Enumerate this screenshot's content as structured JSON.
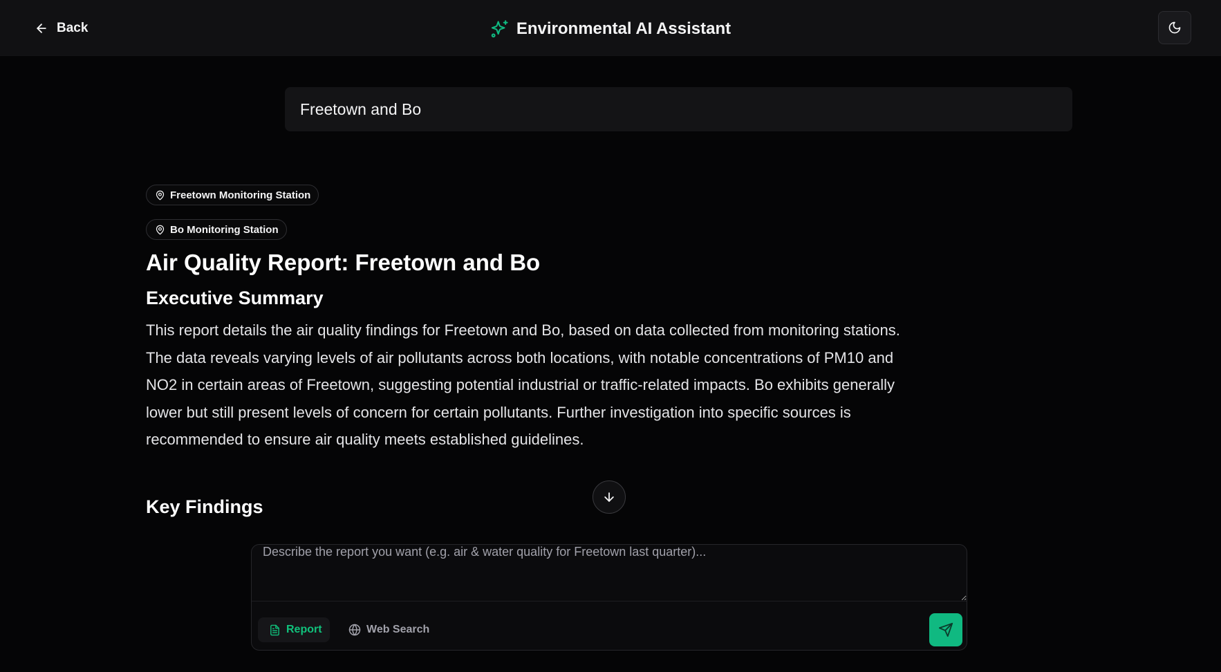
{
  "header": {
    "back_label": "Back",
    "title": "Environmental AI Assistant",
    "accent_color": "#10b981"
  },
  "query": {
    "text": "Freetown and Bo"
  },
  "stations": [
    {
      "label": "Freetown Monitoring Station",
      "icon": "map-pin-icon"
    },
    {
      "label": "Bo Monitoring Station",
      "icon": "map-pin-icon"
    }
  ],
  "report": {
    "title": "Air Quality Report: Freetown and Bo",
    "executive_summary_heading": "Executive Summary",
    "executive_summary": "This report details the air quality findings for Freetown and Bo, based on data collected from monitoring stations. The data reveals varying levels of air pollutants across both locations, with notable concentrations of PM10 and NO2 in certain areas of Freetown, suggesting potential industrial or traffic-related impacts. Bo exhibits generally lower but still present levels of concern for certain pollutants. Further investigation into specific sources is recommended to ensure air quality meets established guidelines.",
    "key_findings_heading": "Key Findings"
  },
  "composer": {
    "placeholder": "Describe the report you want (e.g. air & water quality for Freetown last quarter)...",
    "mode_report_label": "Report",
    "mode_web_label": "Web Search"
  }
}
